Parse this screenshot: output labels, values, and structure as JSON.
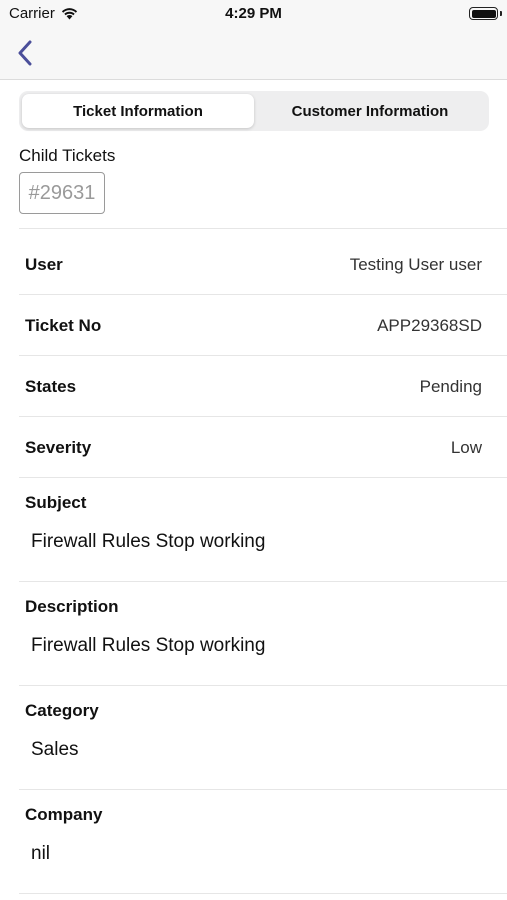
{
  "status_bar": {
    "carrier": "Carrier",
    "time": "4:29 PM",
    "wifi_icon": "wifi-icon",
    "battery_icon": "battery-icon"
  },
  "nav": {
    "back_icon": "chevron-left-icon",
    "accent": "#4b4f9a"
  },
  "tabs": [
    {
      "label": "Ticket Information",
      "active": true
    },
    {
      "label": "Customer Information",
      "active": false
    }
  ],
  "child_tickets": {
    "label": "Child Tickets",
    "items": [
      "#29631"
    ]
  },
  "fields": [
    {
      "label": "User",
      "value": "Testing User user"
    },
    {
      "label": "Ticket No",
      "value": "APP29368SD"
    },
    {
      "label": "States",
      "value": "Pending"
    },
    {
      "label": "Severity",
      "value": "Low"
    }
  ],
  "blocks": [
    {
      "label": "Subject",
      "value": "Firewall Rules Stop working"
    },
    {
      "label": "Description",
      "value": "Firewall Rules Stop working"
    },
    {
      "label": "Category",
      "value": "Sales"
    },
    {
      "label": "Company",
      "value": "nil"
    }
  ]
}
